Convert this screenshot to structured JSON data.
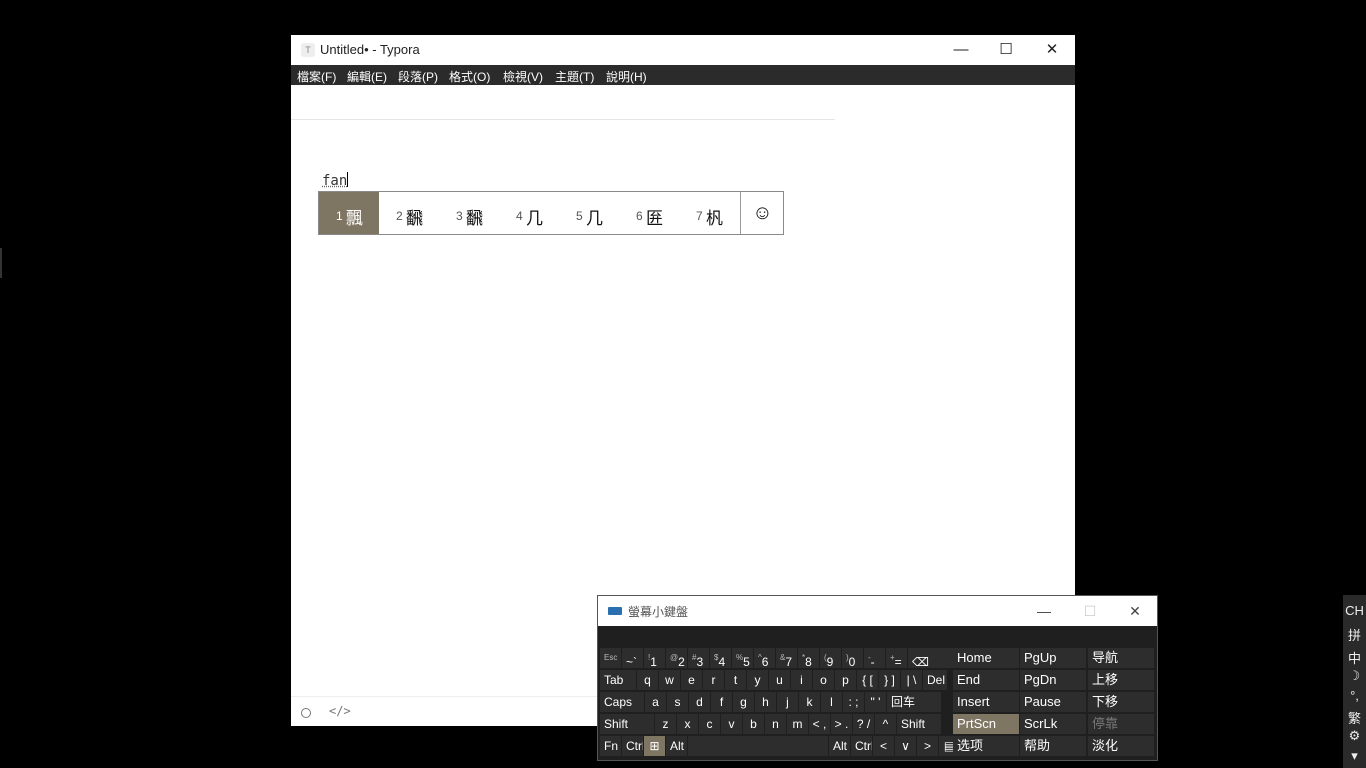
{
  "typora": {
    "app_icon": "T",
    "title": "Untitled• - Typora",
    "controls": {
      "minimize": "—",
      "maximize": "☐",
      "close": "✕"
    },
    "menu": [
      "檔案(F)",
      "編輯(E)",
      "段落(P)",
      "格式(O)",
      "檢視(V)",
      "主題(T)",
      "說明(H)"
    ],
    "typed_text": "fan",
    "status": {
      "circle_icon": "○",
      "code_icon": "</>"
    }
  },
  "ime": {
    "candidates": [
      {
        "num": "1",
        "char": "飄"
      },
      {
        "num": "2",
        "char": "飜"
      },
      {
        "num": "3",
        "char": "飜"
      },
      {
        "num": "4",
        "char": "几"
      },
      {
        "num": "5",
        "char": "几"
      },
      {
        "num": "6",
        "char": "匥"
      },
      {
        "num": "7",
        "char": "杋"
      }
    ],
    "selected_index": 0,
    "emoji": "☺"
  },
  "osk": {
    "title": "螢幕小鍵盤",
    "controls": {
      "minimize": "—",
      "maximize": "☐",
      "close": "✕"
    },
    "row1": [
      {
        "s": "Esc",
        "m": ""
      },
      {
        "s": "",
        "m": "~`"
      },
      {
        "s": "!",
        "m": "1"
      },
      {
        "s": "@",
        "m": "2"
      },
      {
        "s": "#",
        "m": "3"
      },
      {
        "s": "$",
        "m": "4"
      },
      {
        "s": "%",
        "m": "5"
      },
      {
        "s": "^",
        "m": "6"
      },
      {
        "s": "&",
        "m": "7"
      },
      {
        "s": "*",
        "m": "8"
      },
      {
        "s": "(",
        "m": "9"
      },
      {
        "s": ")",
        "m": "0"
      },
      {
        "s": "-",
        "m": "-"
      },
      {
        "s": "+",
        "m": "="
      },
      {
        "s": "",
        "m": "⌫"
      }
    ],
    "row2": [
      "Tab",
      "q",
      "w",
      "e",
      "r",
      "t",
      "y",
      "u",
      "i",
      "o",
      "p",
      "{ [",
      "} ]",
      "| \\",
      "Del"
    ],
    "row3": [
      "Caps",
      "a",
      "s",
      "d",
      "f",
      "g",
      "h",
      "j",
      "k",
      "l",
      ": ;",
      "\" '",
      "回车"
    ],
    "row4": [
      "Shift",
      "z",
      "x",
      "c",
      "v",
      "b",
      "n",
      "m",
      "< ,",
      "> .",
      "? /",
      "^",
      "Shift"
    ],
    "row5": [
      "Fn",
      "Ctrl",
      "⊞",
      "Alt",
      "",
      "Alt",
      "Ctrl",
      "<",
      "∨",
      ">",
      "▤"
    ],
    "nav": [
      [
        "Home",
        "PgUp",
        "导航"
      ],
      [
        "End",
        "PgDn",
        "上移"
      ],
      [
        "Insert",
        "Pause",
        "下移"
      ],
      [
        "PrtScn",
        "ScrLk",
        "停靠"
      ],
      [
        "选项",
        "帮助",
        "淡化"
      ]
    ]
  },
  "tray": [
    "CH",
    "拼",
    "中",
    "☽",
    "°,",
    "繁",
    "⚙",
    "▾"
  ]
}
